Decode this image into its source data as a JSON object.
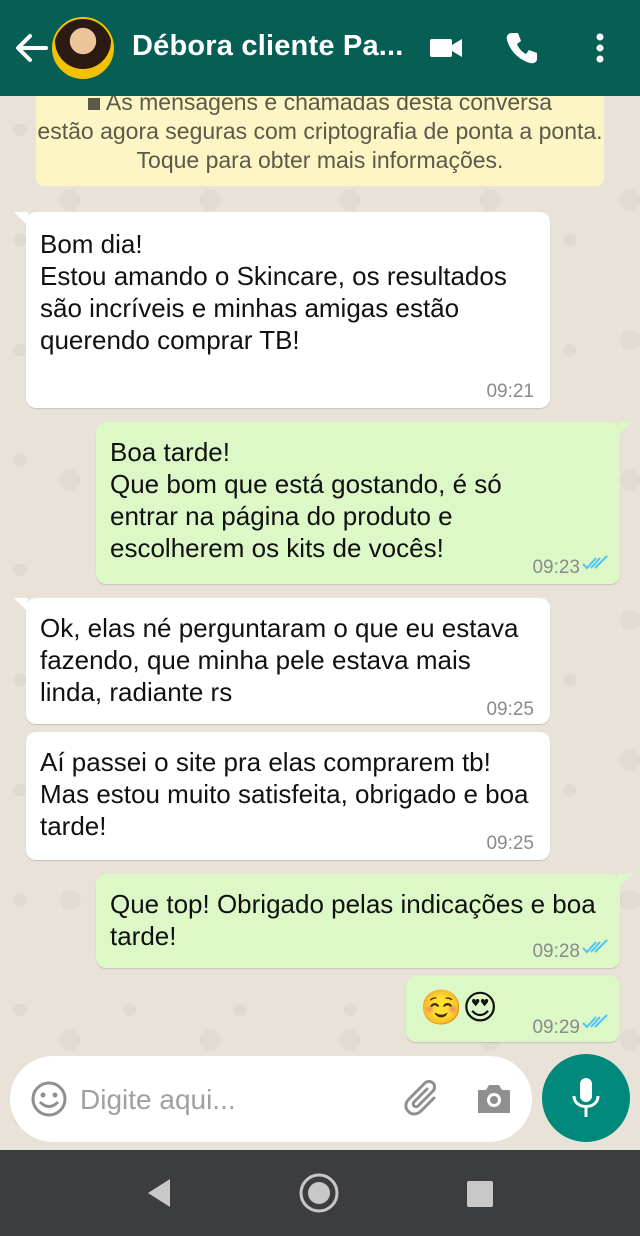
{
  "header": {
    "contact_name": "Débora cliente Pa...",
    "icons": [
      "back-arrow-icon",
      "video-call-icon",
      "phone-icon",
      "more-options-icon"
    ],
    "color": "#075e54"
  },
  "notice": {
    "text_line1": "As mensagens e chamadas desta conversa",
    "text_rest": "estão agora seguras com criptografia de ponta a ponta. Toque para obter mais informações."
  },
  "messages": [
    {
      "direction": "in",
      "text": "Bom dia!\nEstou amando o Skincare, os resultados são incríveis e minhas amigas estão querendo comprar TB!",
      "time": "09:21"
    },
    {
      "direction": "out",
      "text": "Boa tarde!\nQue bom que está gostando, é só entrar na página do produto e escolherem os kits de vocês!",
      "time": "09:23",
      "status": "read"
    },
    {
      "direction": "in",
      "text": "Ok, elas né perguntaram o que eu estava fazendo, que minha pele estava mais linda, radiante rs",
      "time": "09:25"
    },
    {
      "direction": "in",
      "text": "Aí passei o site pra elas comprarem tb! Mas estou muito satisfeita, obrigado e boa tarde!",
      "time": "09:25"
    },
    {
      "direction": "out",
      "text": "Que top! Obrigado pelas indicações e boa tarde!",
      "time": "09:28",
      "status": "read"
    },
    {
      "direction": "out",
      "text": "☺️😍",
      "time": "09:29",
      "status": "read"
    }
  ],
  "composer": {
    "placeholder": "Digite aqui...",
    "icons": [
      "emoji-icon",
      "attachment-icon",
      "camera-icon",
      "microphone-icon"
    ],
    "send_color": "#00897b"
  },
  "colors": {
    "incoming_bubble": "#ffffff",
    "outgoing_bubble": "#dcf8c6",
    "read_ticks": "#4fc3f7"
  }
}
